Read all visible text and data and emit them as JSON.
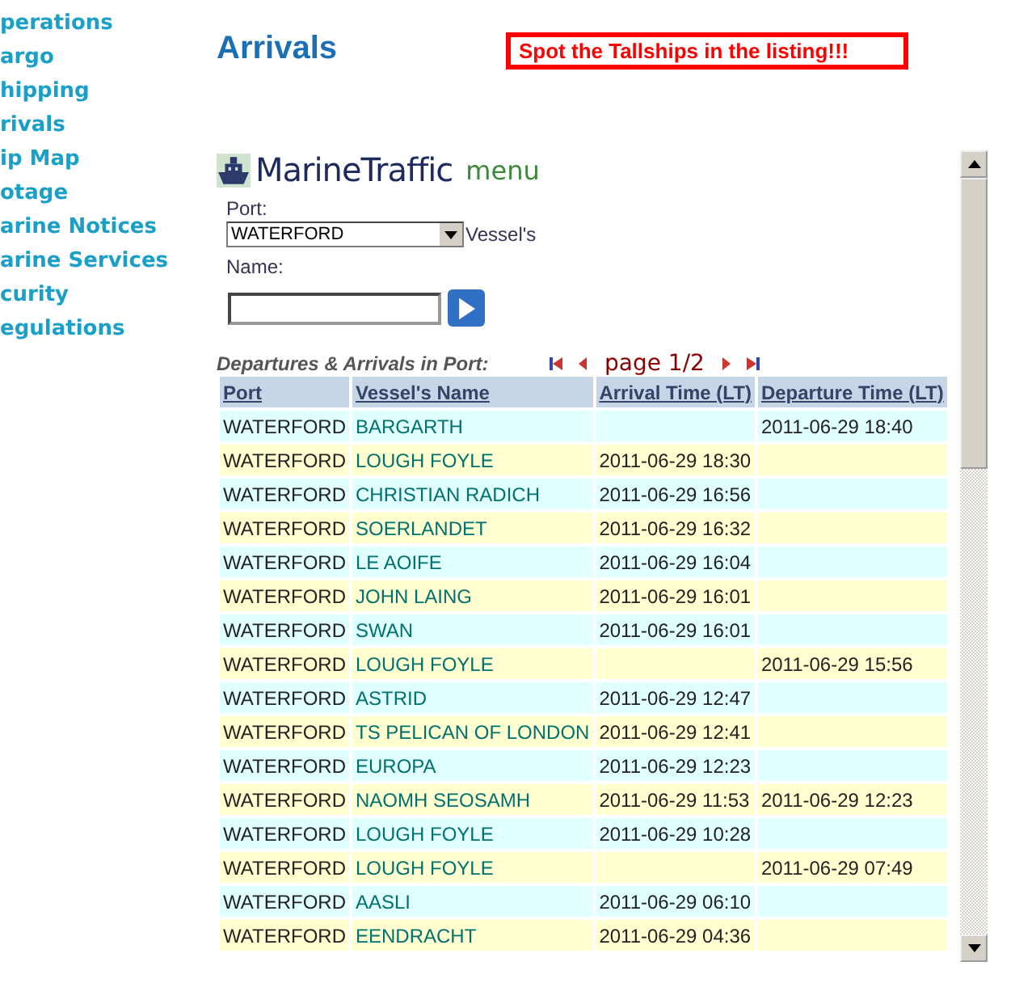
{
  "sidebar": {
    "items": [
      "perations",
      "argo",
      "hipping",
      "rivals",
      "ip Map",
      "otage",
      "arine Notices",
      "arine Services",
      "curity",
      "egulations"
    ]
  },
  "page_title": "Arrivals",
  "notice": "Spot the Tallships in the listing!!!",
  "widget": {
    "brand": "MarineTraffic",
    "menu": "menu",
    "port_label": "Port:",
    "port_value": "WATERFORD",
    "vessel_label_1": "Vessel's",
    "vessel_label_2": "Name:",
    "table_title": "Departures & Arrivals in Port:",
    "pager": "page 1/2",
    "columns": [
      "Port",
      "Vessel's Name",
      "Arrival Time (LT)",
      "Departure Time (LT)"
    ],
    "rows": [
      [
        "WATERFORD",
        "BARGARTH",
        "",
        "2011-06-29 18:40"
      ],
      [
        "WATERFORD",
        "LOUGH FOYLE",
        "2011-06-29 18:30",
        ""
      ],
      [
        "WATERFORD",
        "CHRISTIAN RADICH",
        "2011-06-29 16:56",
        ""
      ],
      [
        "WATERFORD",
        "SOERLANDET",
        "2011-06-29 16:32",
        ""
      ],
      [
        "WATERFORD",
        "LE AOIFE",
        "2011-06-29 16:04",
        ""
      ],
      [
        "WATERFORD",
        "JOHN LAING",
        "2011-06-29 16:01",
        ""
      ],
      [
        "WATERFORD",
        "SWAN",
        "2011-06-29 16:01",
        ""
      ],
      [
        "WATERFORD",
        "LOUGH FOYLE",
        "",
        "2011-06-29 15:56"
      ],
      [
        "WATERFORD",
        "ASTRID",
        "2011-06-29 12:47",
        ""
      ],
      [
        "WATERFORD",
        "TS PELICAN OF LONDON",
        "2011-06-29 12:41",
        ""
      ],
      [
        "WATERFORD",
        "EUROPA",
        "2011-06-29 12:23",
        ""
      ],
      [
        "WATERFORD",
        "NAOMH SEOSAMH",
        "2011-06-29 11:53",
        "2011-06-29 12:23"
      ],
      [
        "WATERFORD",
        "LOUGH FOYLE",
        "2011-06-29 10:28",
        ""
      ],
      [
        "WATERFORD",
        "LOUGH FOYLE",
        "",
        "2011-06-29 07:49"
      ],
      [
        "WATERFORD",
        "AASLI",
        "2011-06-29 06:10",
        ""
      ],
      [
        "WATERFORD",
        "EENDRACHT",
        "2011-06-29 04:36",
        ""
      ]
    ]
  }
}
